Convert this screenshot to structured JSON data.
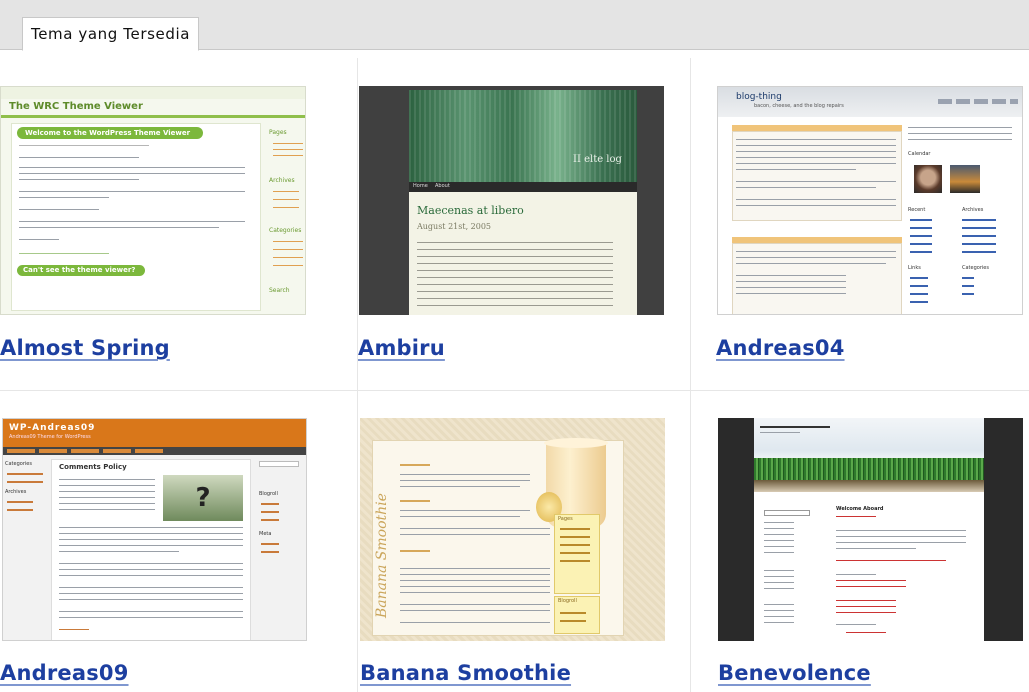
{
  "tab": {
    "label": "Tema yang Tersedia"
  },
  "themes": [
    {
      "name": "Almost Spring",
      "thumb": {
        "site_title": "The WRC Theme Viewer",
        "post_title": "Welcome to the WordPress Theme Viewer",
        "box2_title": "Can't see the theme viewer?",
        "sidebar": [
          "Pages",
          "Archives",
          "Categories",
          "Search"
        ]
      }
    },
    {
      "name": "Ambiru",
      "thumb": {
        "header_title": "II elte log",
        "nav": [
          "Home",
          "About"
        ],
        "post_title": "Maecenas at libero",
        "post_date": "August 21st, 2005"
      }
    },
    {
      "name": "Andreas04",
      "thumb": {
        "site_title": "blog-thing",
        "tagline": "bacon, cheese, and the blog repairs",
        "sidebar": [
          "Calendar",
          "Recent",
          "Archives",
          "Links",
          "Categories"
        ]
      }
    },
    {
      "name": "Andreas09",
      "thumb": {
        "site_title": "WP-Andreas09",
        "tagline": "Andreas09 Theme for WordPress",
        "post_title": "Comments Policy",
        "sidebar": [
          "Categories",
          "Archives",
          "Blogroll",
          "Meta"
        ]
      }
    },
    {
      "name": "Banana Smoothie",
      "thumb": {
        "logo_text": "Banana Smoothie",
        "sidebar": [
          "Pages",
          "Blogroll"
        ]
      }
    },
    {
      "name": "Benevolence",
      "thumb": {
        "post_title": "Welcome Aboard"
      }
    }
  ],
  "colors": {
    "link": "#1d3fa0",
    "spring_green": "#6fae35",
    "andreas09_orange": "#d9771a",
    "ambiru_green": "#2f6c45"
  }
}
